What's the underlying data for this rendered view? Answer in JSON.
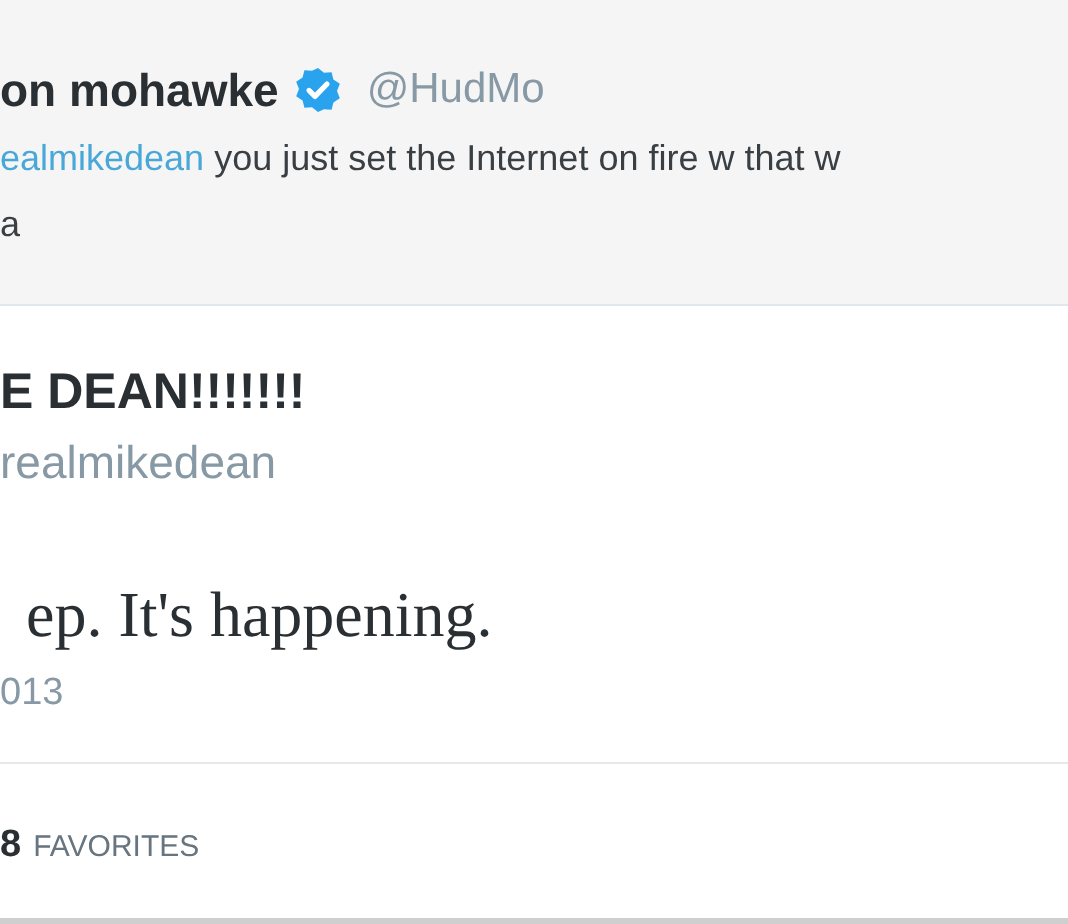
{
  "parent_tweet": {
    "author_name": "on mohawke",
    "verified": true,
    "handle": "@HudMo",
    "mention": "ealmikedean",
    "text": "you just set the Internet on fire w that w",
    "text_line_2": "a"
  },
  "tweet": {
    "author_name": "E DEAN!!!!!!!",
    "handle": "realmikedean",
    "text": "ep. It's happening.",
    "timestamp": "013"
  },
  "stats": {
    "count": "8",
    "label": "FAVORITES"
  }
}
